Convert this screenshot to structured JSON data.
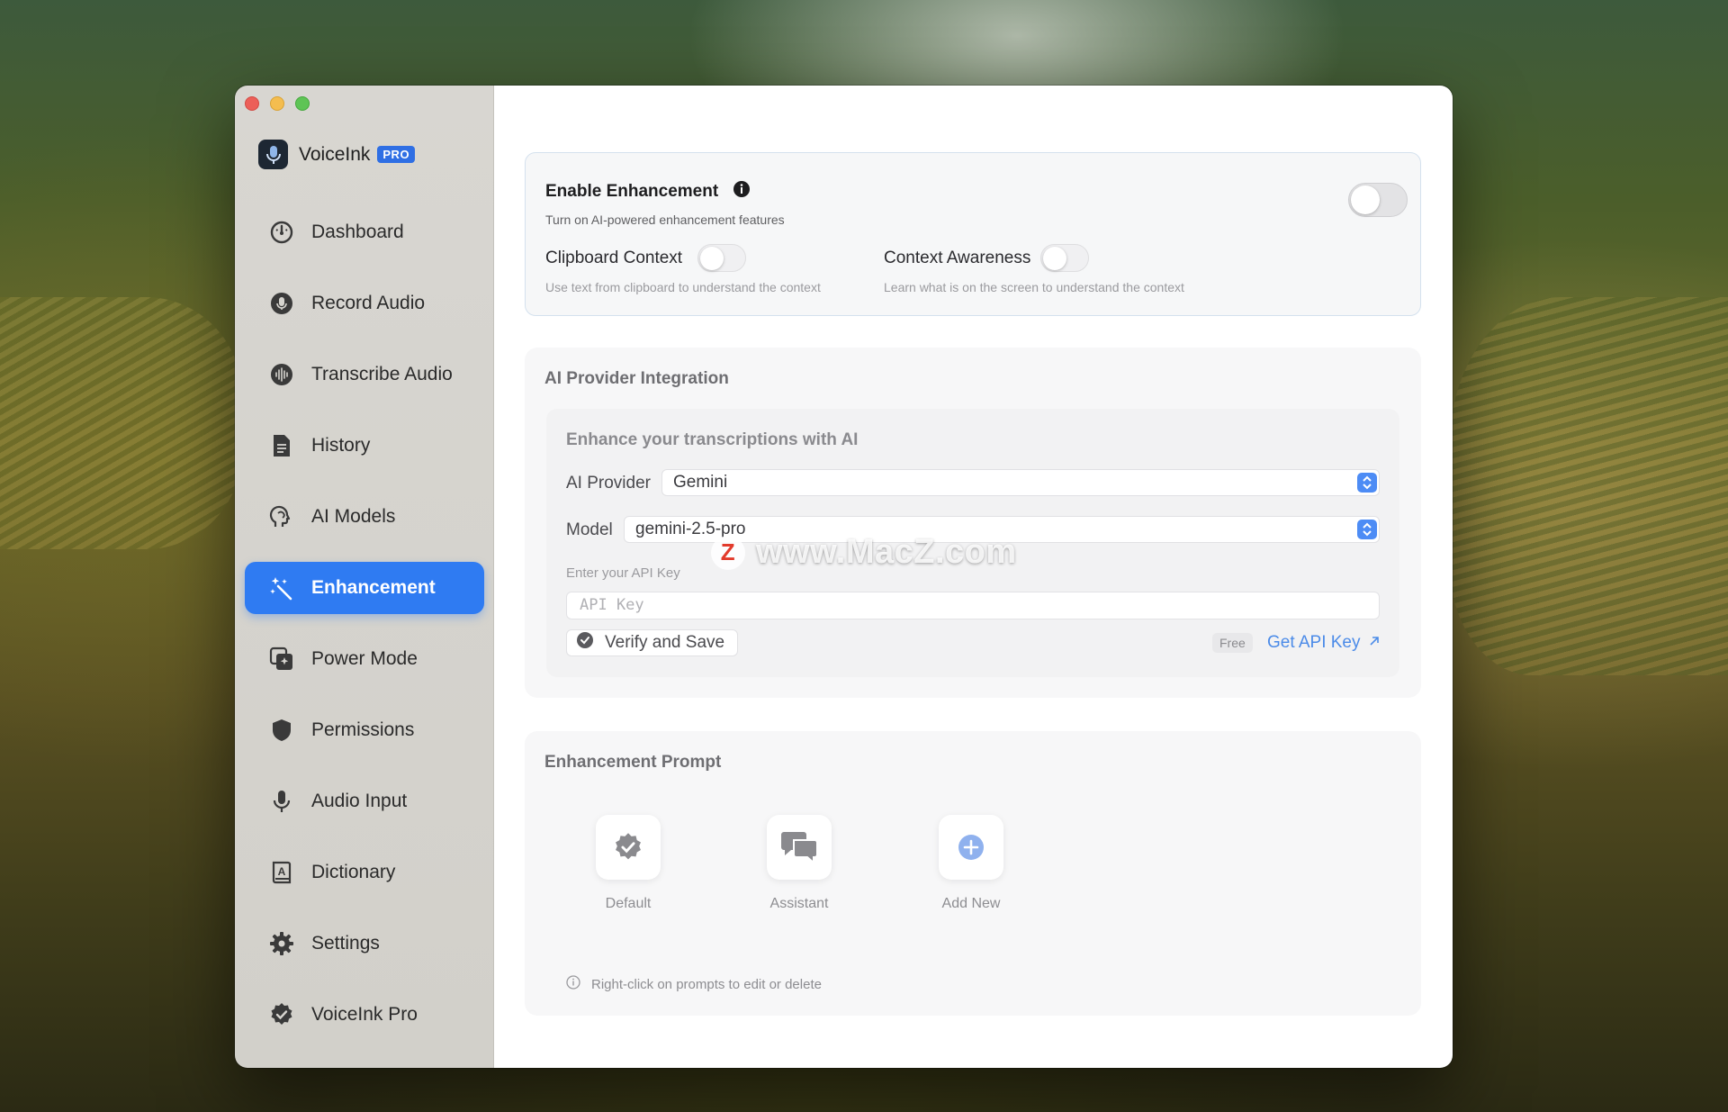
{
  "app": {
    "name": "VoiceInk",
    "badge": "PRO"
  },
  "sidebar": {
    "items": [
      {
        "label": "Dashboard",
        "icon": "gauge-icon",
        "active": false
      },
      {
        "label": "Record Audio",
        "icon": "mic-circle-icon",
        "active": false
      },
      {
        "label": "Transcribe Audio",
        "icon": "waveform-circle-icon",
        "active": false
      },
      {
        "label": "History",
        "icon": "document-icon",
        "active": false
      },
      {
        "label": "AI Models",
        "icon": "brain-head-icon",
        "active": false
      },
      {
        "label": "Enhancement",
        "icon": "sparkles-wand-icon",
        "active": true
      },
      {
        "label": "Power Mode",
        "icon": "sparkles-square-icon",
        "active": false
      },
      {
        "label": "Permissions",
        "icon": "shield-icon",
        "active": false
      },
      {
        "label": "Audio Input",
        "icon": "microphone-icon",
        "active": false
      },
      {
        "label": "Dictionary",
        "icon": "character-book-icon",
        "active": false
      },
      {
        "label": "Settings",
        "icon": "gear-icon",
        "active": false
      },
      {
        "label": "VoiceInk Pro",
        "icon": "checkmark-seal-icon",
        "active": false
      }
    ]
  },
  "enhancement": {
    "title": "Enable Enhancement",
    "subtitle": "Turn on AI-powered enhancement features",
    "enabled": false,
    "clipboard": {
      "label": "Clipboard Context",
      "desc": "Use text from clipboard to understand the context",
      "enabled": false
    },
    "awareness": {
      "label": "Context Awareness",
      "desc": "Learn what is on the screen to understand the context",
      "enabled": false
    }
  },
  "provider": {
    "section_title": "AI Provider Integration",
    "inner_title": "Enhance your transcriptions with AI",
    "provider_label": "AI Provider",
    "provider_value": "Gemini",
    "model_label": "Model",
    "model_value": "gemini-2.5-pro",
    "api_key_label": "Enter your API Key",
    "api_key_placeholder": "API Key",
    "verify_label": "Verify and Save",
    "free_badge": "Free",
    "get_key_label": "Get API Key"
  },
  "prompt": {
    "section_title": "Enhancement Prompt",
    "tiles": [
      {
        "label": "Default",
        "icon": "checkmark-seal-icon"
      },
      {
        "label": "Assistant",
        "icon": "chat-bubbles-icon"
      },
      {
        "label": "Add New",
        "icon": "plus-circle-icon"
      }
    ],
    "hint": "Right-click on prompts to edit or delete"
  },
  "watermark": {
    "text": "www.MacZ.com",
    "logo_letter": "Z"
  },
  "colors": {
    "accent": "#2f7bf2",
    "link": "#4b8be8"
  }
}
